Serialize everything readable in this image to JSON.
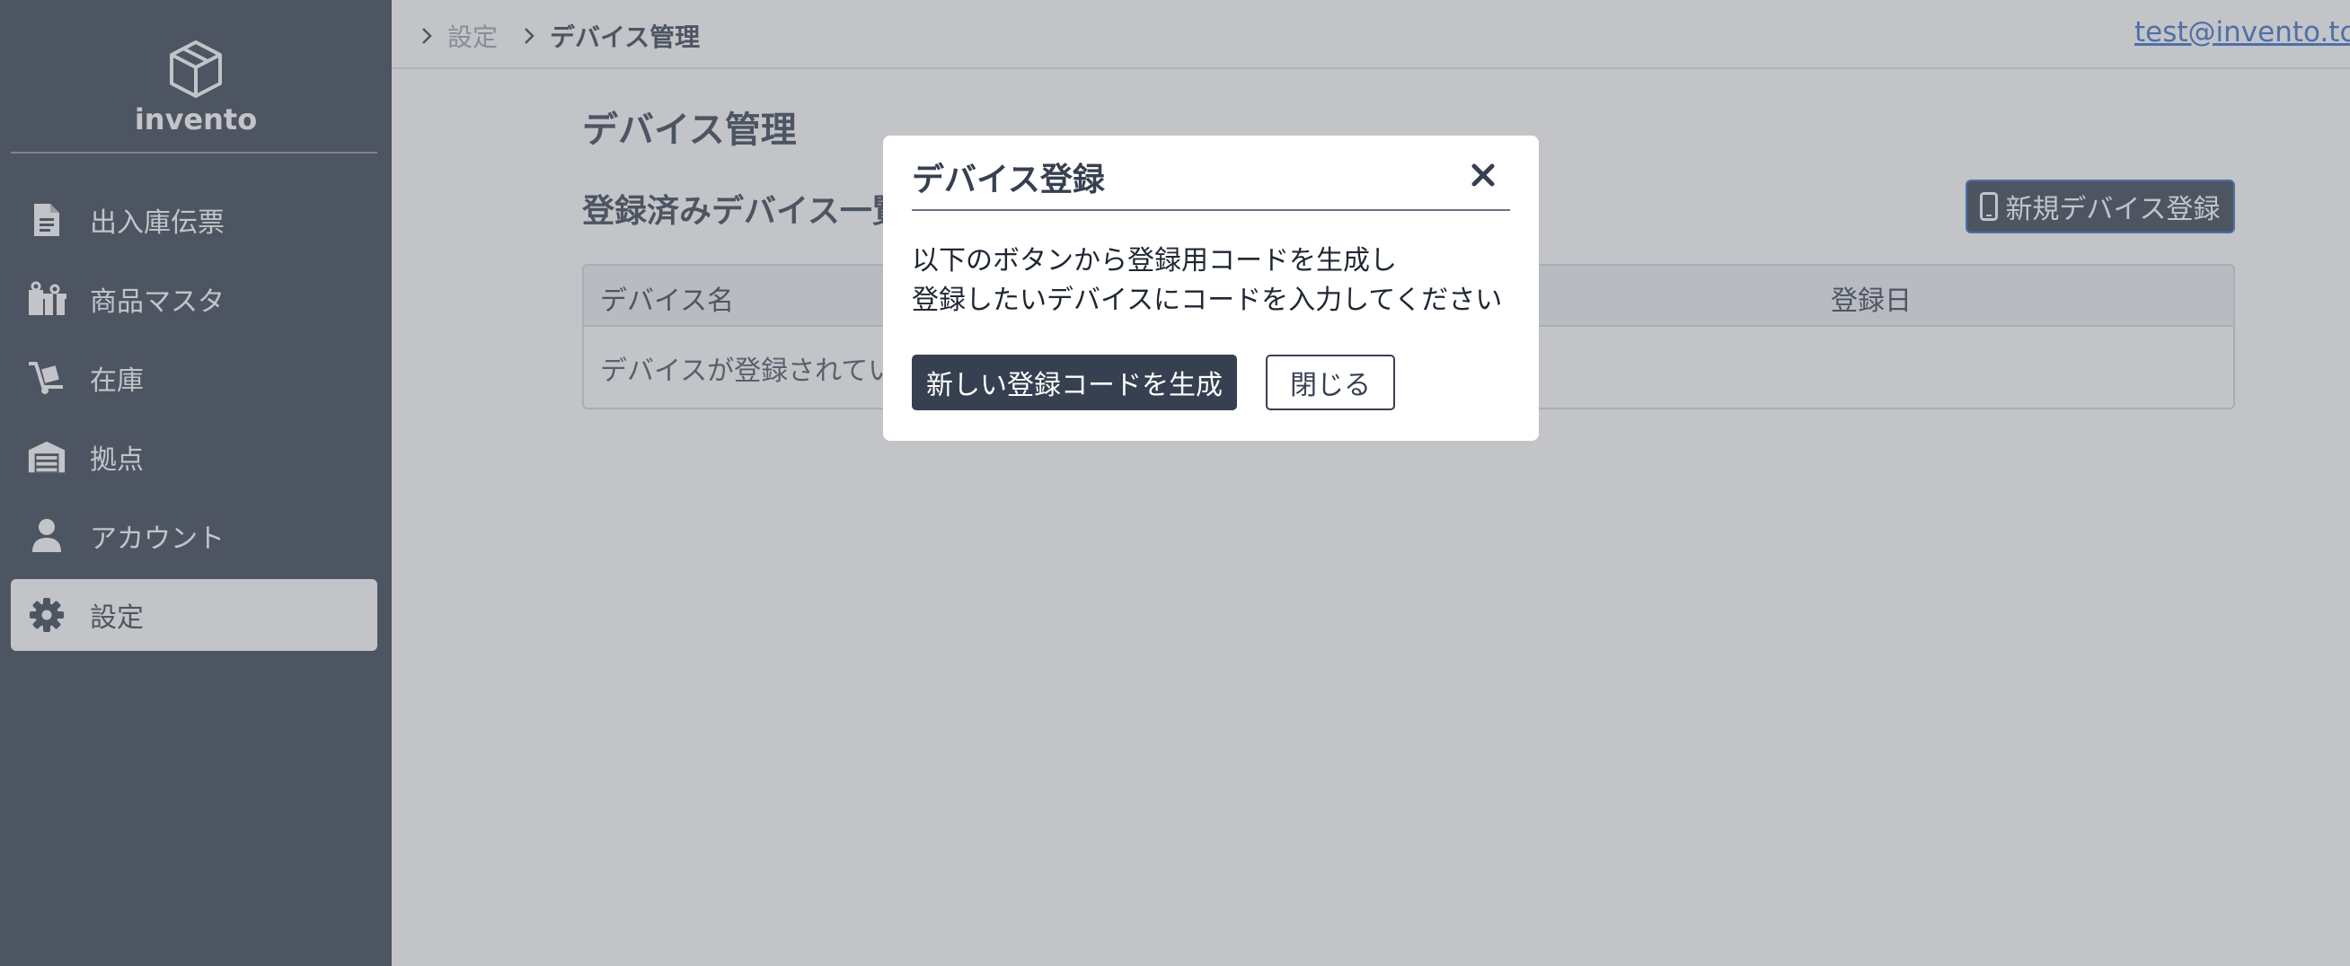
{
  "app": {
    "name": "invento"
  },
  "sidebar": {
    "items": [
      {
        "label": "出入庫伝票",
        "icon": "document-icon"
      },
      {
        "label": "商品マスタ",
        "icon": "gifts-icon"
      },
      {
        "label": "在庫",
        "icon": "dolly-icon"
      },
      {
        "label": "拠点",
        "icon": "warehouse-icon"
      },
      {
        "label": "アカウント",
        "icon": "user-icon"
      },
      {
        "label": "設定",
        "icon": "gear-icon",
        "active": true
      }
    ]
  },
  "header": {
    "breadcrumb": [
      "設定",
      "デバイス管理"
    ],
    "user_email": "test@invento.tc-i"
  },
  "page": {
    "title": "デバイス管理",
    "section_title": "登録済みデバイス一覧",
    "new_device_button": "新規デバイス登録",
    "table": {
      "columns": [
        "デバイス名",
        "登録日"
      ],
      "empty_message": "デバイスが登録されていません"
    }
  },
  "modal": {
    "title": "デバイス登録",
    "message_line1": "以下のボタンから登録用コードを生成し",
    "message_line2": "登録したいデバイスにコードを入力してください",
    "generate_button": "新しい登録コードを生成",
    "close_button": "閉じる"
  },
  "colors": {
    "sidebar_bg": "#374050",
    "primary": "#374050",
    "link": "#3a6fc7"
  }
}
